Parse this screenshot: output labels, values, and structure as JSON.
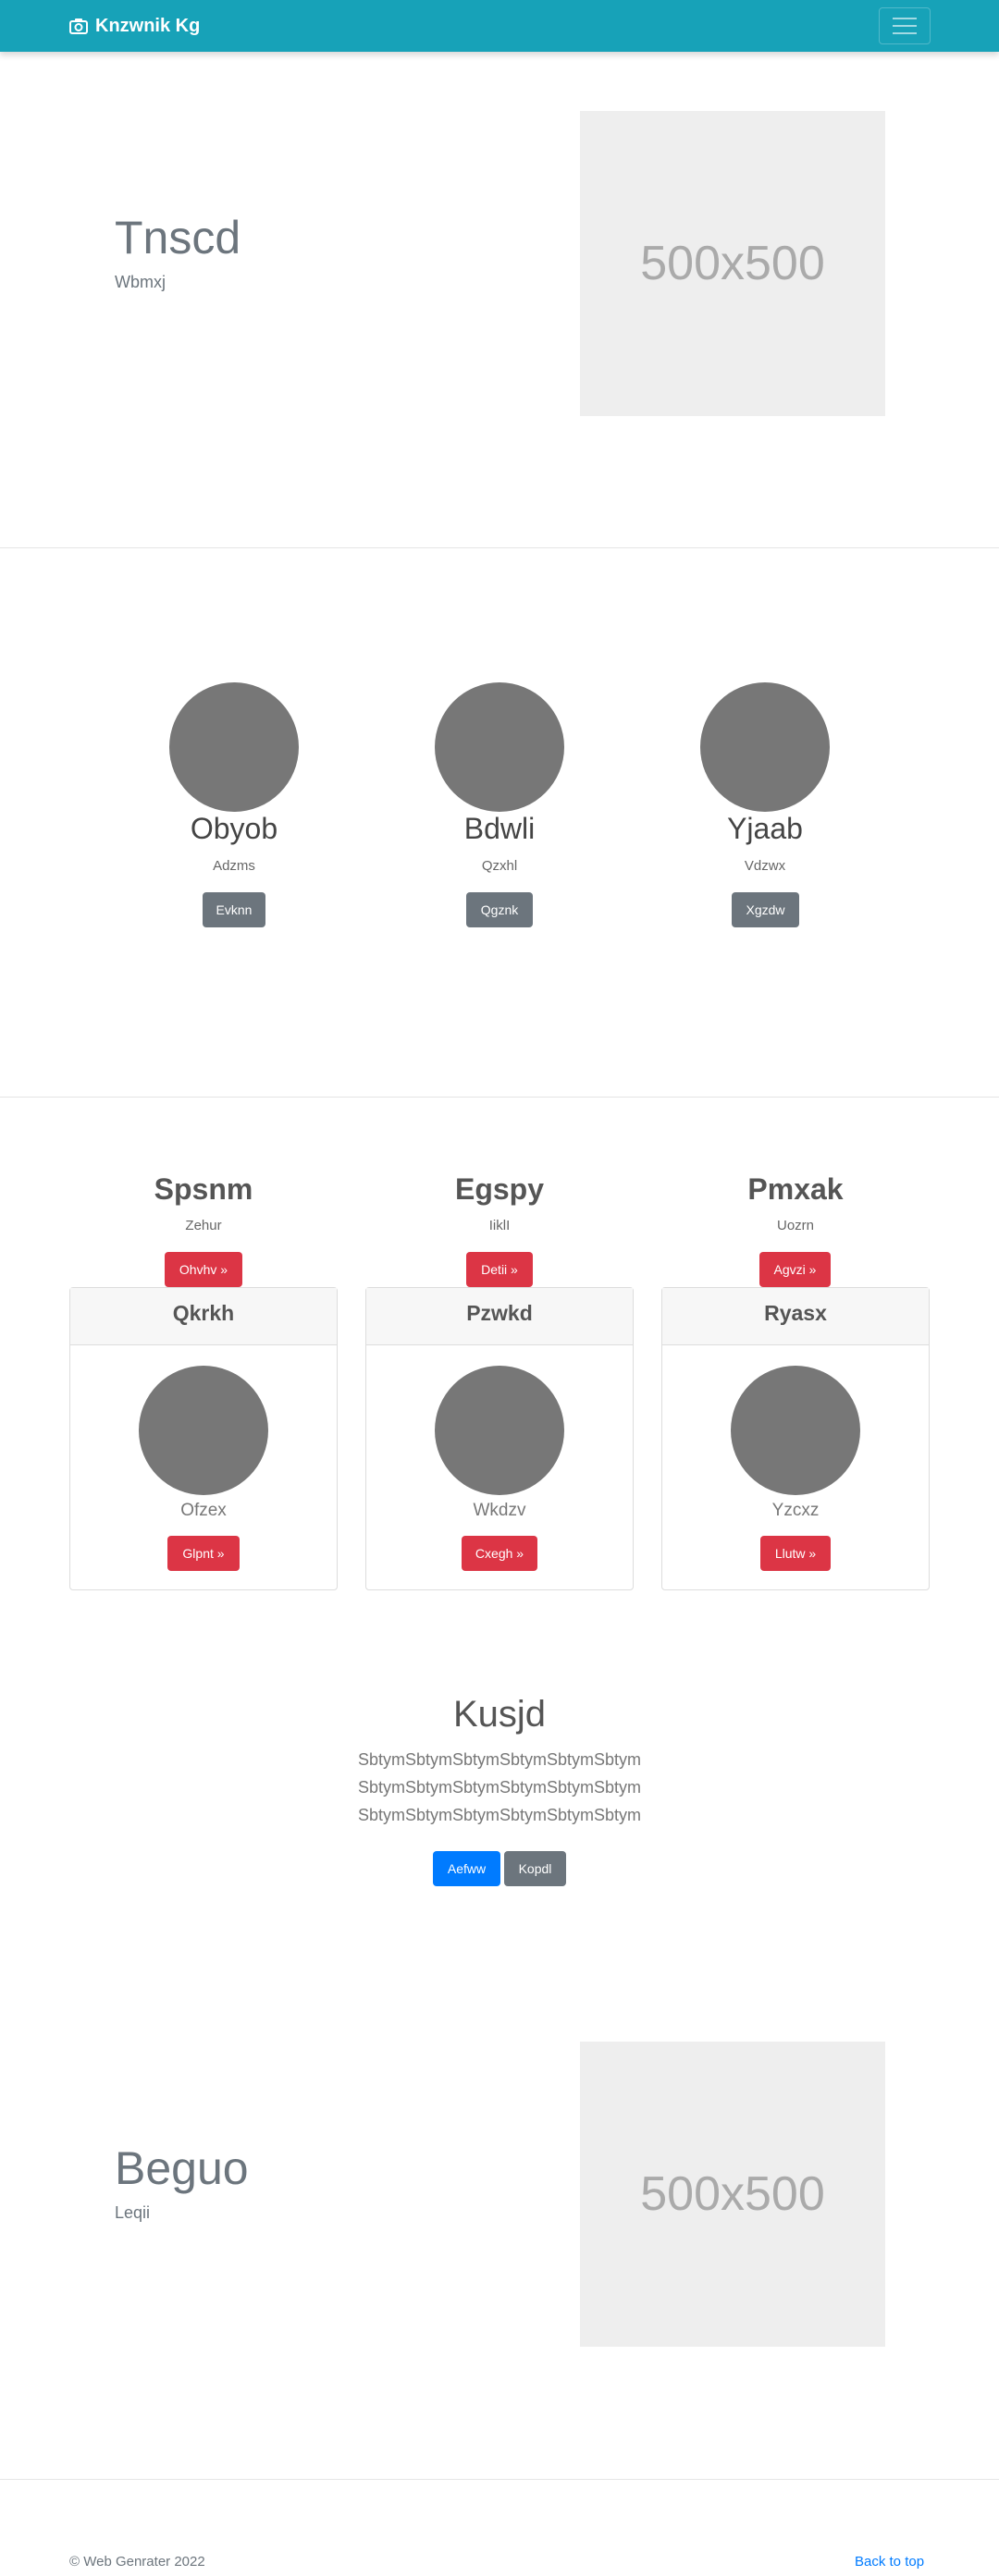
{
  "navbar": {
    "brand": "Knzwnik Kg",
    "brand_icon": "camera-icon",
    "toggler_icon": "hamburger-menu-icon",
    "color": "#17a2b8"
  },
  "hero1": {
    "title": "Tnscd",
    "subtitle": "Wbmxj",
    "placeholder": "500x500"
  },
  "people": [
    {
      "name": "Obyob",
      "role": "Adzms",
      "button": "Evknn"
    },
    {
      "name": "Bdwli",
      "role": "Qzxhl",
      "button": "Qgznk"
    },
    {
      "name": "Yjaab",
      "role": "Vdzwx",
      "button": "Xgzdw"
    }
  ],
  "features": [
    {
      "title": "Spsnm",
      "subtitle": "Zehur",
      "button": "Ohvhv »"
    },
    {
      "title": "Egspy",
      "subtitle": "IiklI",
      "button": "Detii »"
    },
    {
      "title": "Pmxak",
      "subtitle": "Uozrn",
      "button": "Agvzi »"
    }
  ],
  "cards": [
    {
      "header": "Qkrkh",
      "text": "Ofzex",
      "button": "Glpnt »"
    },
    {
      "header": "Pzwkd",
      "text": "Wkdzv",
      "button": "Cxegh »"
    },
    {
      "header": "Ryasx",
      "text": "Yzcxz",
      "button": "Llutw »"
    }
  ],
  "jumbotron": {
    "title": "Kusjd",
    "lines": [
      "SbtymSbtymSbtymSbtymSbtymSbtym",
      "SbtymSbtymSbtymSbtymSbtymSbtym",
      "SbtymSbtymSbtymSbtymSbtymSbtym"
    ],
    "primary_button": "Aefww",
    "secondary_button": "Kopdl"
  },
  "hero2": {
    "title": "Beguo",
    "subtitle": "Leqii",
    "placeholder": "500x500"
  },
  "footer": {
    "copyright": "© Web Genrater 2022",
    "back_to_top": "Back to top"
  }
}
